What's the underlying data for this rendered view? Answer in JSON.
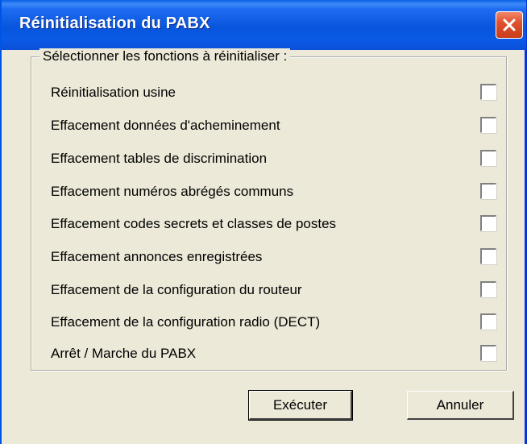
{
  "window": {
    "title": "Réinitialisation du PABX"
  },
  "group": {
    "legend": "Sélectionner les fonctions à réinitialiser :"
  },
  "options": [
    {
      "label": "Réinitialisation usine",
      "checked": false
    },
    {
      "label": "Effacement données d'acheminement",
      "checked": false
    },
    {
      "label": "Effacement tables de discrimination",
      "checked": false
    },
    {
      "label": "Effacement numéros abrégés communs",
      "checked": false
    },
    {
      "label": "Effacement codes secrets et classes de postes",
      "checked": false
    },
    {
      "label": "Effacement annonces enregistrées",
      "checked": false
    },
    {
      "label": "Effacement de la configuration du routeur",
      "checked": false
    },
    {
      "label": "Effacement de la configuration radio (DECT)",
      "checked": false
    },
    {
      "label": "Arrêt / Marche du PABX",
      "checked": false
    }
  ],
  "buttons": {
    "execute_label": "Exécuter",
    "cancel_label": "Annuler"
  },
  "colors": {
    "titlebar": "#0855dd",
    "dialog_background": "#ece9d8",
    "close_button": "#e0512f"
  },
  "icons": {
    "close": "close-icon"
  }
}
